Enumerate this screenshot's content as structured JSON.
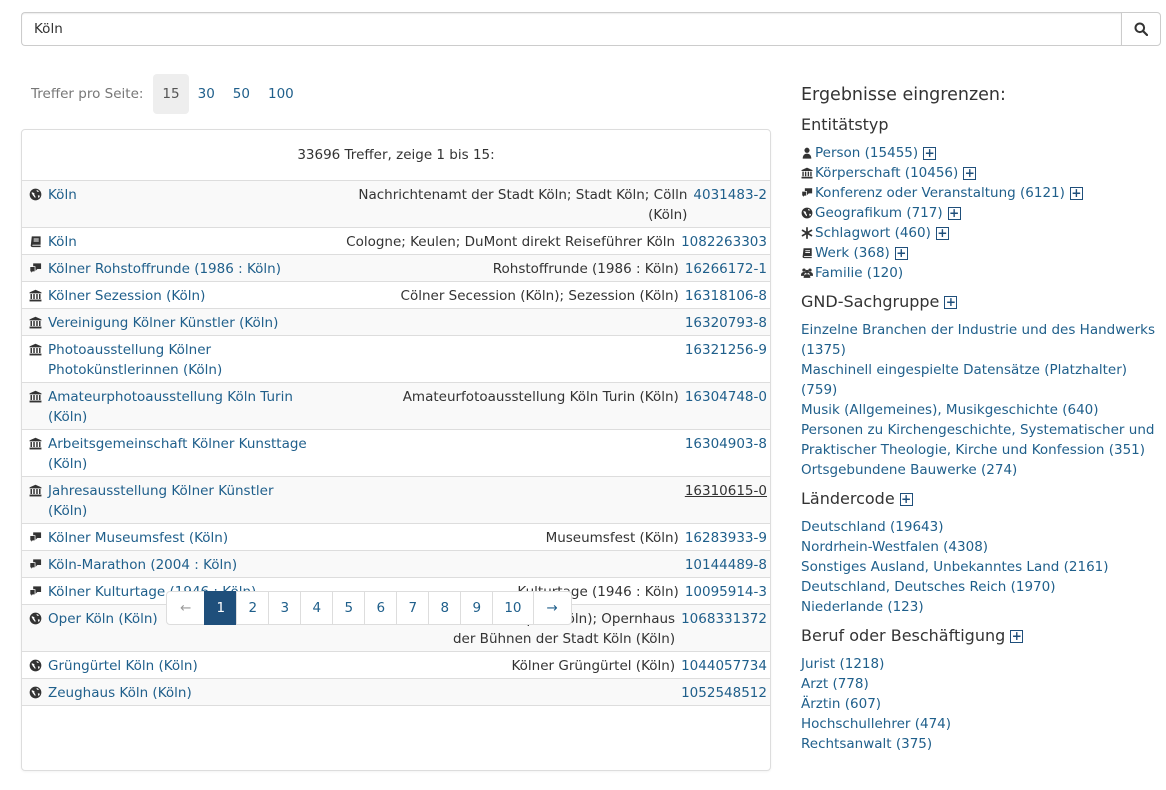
{
  "search": {
    "value": "Köln"
  },
  "perpage": {
    "label": "Treffer pro Seite:",
    "options": [
      "15",
      "30",
      "50",
      "100"
    ],
    "active": "15"
  },
  "results": {
    "summary": "33696 Treffer, zeige 1 bis 15:",
    "rows": [
      {
        "icon": "globe-icon",
        "name": "Köln",
        "alt": "Nachrichtenamt der Stadt Köln; Stadt Köln; Cölln (Köln)",
        "id": "4031483-2"
      },
      {
        "icon": "book-icon",
        "name": "Köln",
        "alt": "Cologne; Keulen; DuMont direkt Reiseführer Köln",
        "id": "1082263303"
      },
      {
        "icon": "conference-icon",
        "name": "Kölner Rohstoffrunde (1986 : Köln)",
        "alt": "Rohstoffrunde (1986 : Köln)",
        "id": "16266172-1"
      },
      {
        "icon": "institution-icon",
        "name": "Kölner Sezession (Köln)",
        "alt": "Cölner Secession (Köln); Sezession (Köln)",
        "id": "16318106-8"
      },
      {
        "icon": "institution-icon",
        "name": "Vereinigung Kölner Künstler (Köln)",
        "alt": "",
        "id": "16320793-8"
      },
      {
        "icon": "institution-icon",
        "name": "Photoausstellung Kölner Photokünstlerinnen (Köln)",
        "alt": "",
        "id": "16321256-9"
      },
      {
        "icon": "institution-icon",
        "name": "Amateurphotoausstellung Köln Turin (Köln)",
        "alt": "Amateurfotoausstellung Köln Turin (Köln)",
        "id": "16304748-0"
      },
      {
        "icon": "institution-icon",
        "name": "Arbeitsgemeinschaft Kölner Kunsttage (Köln)",
        "alt": "",
        "id": "16304903-8"
      },
      {
        "icon": "institution-icon",
        "name": "Jahresausstellung Kölner Künstler (Köln)",
        "alt": "",
        "id": "16310615-0"
      },
      {
        "icon": "conference-icon",
        "name": "Kölner Museumsfest (Köln)",
        "alt": "Museumsfest (Köln)",
        "id": "16283933-9"
      },
      {
        "icon": "conference-icon",
        "name": "Köln-Marathon (2004 : Köln)",
        "alt": "",
        "id": "10144489-8"
      },
      {
        "icon": "conference-icon",
        "name": "Kölner Kulturtage (1946 : Köln)",
        "alt": "Kulturtage (1946 : Köln)",
        "id": "10095914-3"
      },
      {
        "icon": "globe-icon",
        "name": "Oper Köln (Köln)",
        "alt": "Großes Haus (Köln); Neue Oper (Köln); Opernhaus der Bühnen der Stadt Köln (Köln)",
        "id": "1068331372"
      },
      {
        "icon": "globe-icon",
        "name": "Grüngürtel Köln (Köln)",
        "alt": "Kölner Grüngürtel (Köln)",
        "id": "1044057734"
      },
      {
        "icon": "globe-icon",
        "name": "Zeughaus Köln (Köln)",
        "alt": "",
        "id": "1052548512"
      }
    ]
  },
  "pager": {
    "prev": "←",
    "pages": [
      "1",
      "2",
      "3",
      "4",
      "5",
      "6",
      "7",
      "8",
      "9",
      "10"
    ],
    "active": "1",
    "next": "→"
  },
  "facets": {
    "title": "Ergebnisse eingrenzen:",
    "entity": {
      "heading": "Entitätstyp",
      "items": [
        {
          "icon": "person-icon",
          "label": "Person (15455)",
          "plus": true
        },
        {
          "icon": "institution-icon",
          "label": "Körperschaft (10456)",
          "plus": true
        },
        {
          "icon": "conference-icon",
          "label": "Konferenz oder Veranstaltung (6121)",
          "plus": true
        },
        {
          "icon": "globe-icon",
          "label": "Geografikum (717)",
          "plus": true
        },
        {
          "icon": "asterisk-icon",
          "label": "Schlagwort (460)",
          "plus": true
        },
        {
          "icon": "book-icon",
          "label": "Werk (368)",
          "plus": true
        },
        {
          "icon": "family-icon",
          "label": "Familie (120)",
          "plus": false
        }
      ]
    },
    "gnd": {
      "heading": "GND-Sachgruppe",
      "items": [
        "Einzelne Branchen der Industrie und des Handwerks (1375)",
        "Maschinell eingespielte Datensätze (Platzhalter) (759)",
        "Musik (Allgemeines), Musikgeschichte (640)",
        "Personen zu Kirchengeschichte, Systematischer und Praktischer Theologie, Kirche und Konfession (351)",
        "Ortsgebundene Bauwerke (274)"
      ]
    },
    "country": {
      "heading": "Ländercode",
      "items": [
        "Deutschland (19643)",
        "Nordrhein-Westfalen (4308)",
        "Sonstiges Ausland, Unbekanntes Land (2161)",
        "Deutschland, Deutsches Reich (1970)",
        "Niederlande (123)"
      ]
    },
    "profession": {
      "heading": "Beruf oder Beschäftigung",
      "items": [
        "Jurist (1218)",
        "Arzt (778)",
        "Ärztin (607)",
        "Hochschullehrer (474)",
        "Rechtsanwalt (375)"
      ]
    }
  }
}
